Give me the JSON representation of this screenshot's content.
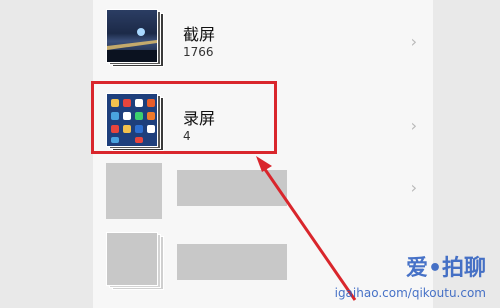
{
  "albums": [
    {
      "name": "截屏",
      "count": "1766"
    },
    {
      "name": "录屏",
      "count": "4"
    }
  ],
  "chevron_glyph": "›",
  "watermark": {
    "text": "爱•拍聊",
    "url": "igaihao.com/qikoutu.com"
  }
}
